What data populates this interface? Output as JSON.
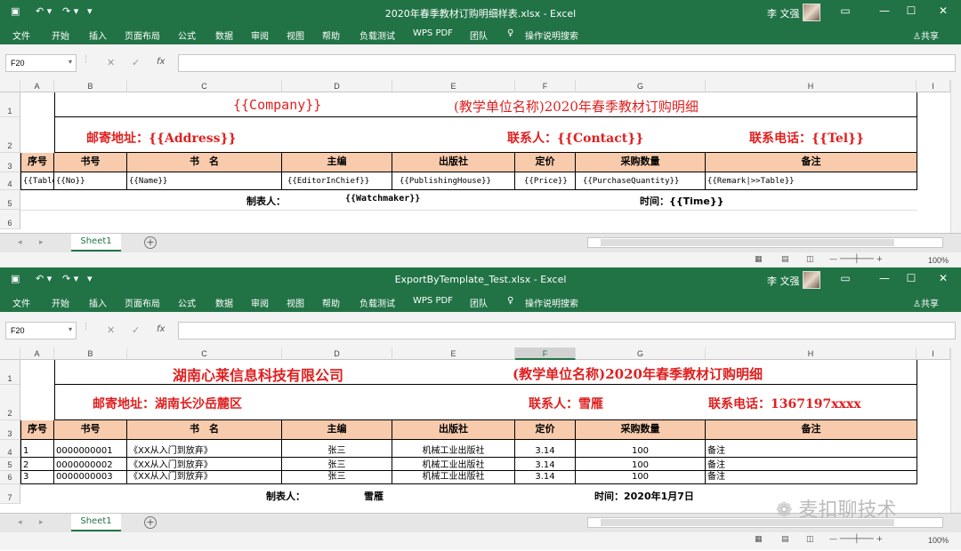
{
  "ribbon_tabs": [
    "文件",
    "开始",
    "插入",
    "页面布局",
    "公式",
    "数据",
    "审阅",
    "视图",
    "帮助",
    "负载测试",
    "WPS PDF",
    "团队"
  ],
  "tell_me": "操作说明搜索",
  "share": "共享",
  "user": "李 文强",
  "name_box": "F20",
  "fx": "fx",
  "columns": [
    "A",
    "B",
    "C",
    "D",
    "E",
    "F",
    "G",
    "H",
    "I"
  ],
  "sheet_tab": "Sheet1",
  "zoom": "100%",
  "template": {
    "title": "2020年春季教材订购明细样表.xlsx  -  Excel",
    "rows": [
      "1",
      "2",
      "3",
      "4",
      "5",
      "6"
    ],
    "company": "{{Company}}",
    "heading": "(教学单位名称)2020年春季教材订购明细",
    "address": "邮寄地址：{{Address}}",
    "contact": "联系人：{{Contact}}",
    "tel": "联系电话：{{Tel}}",
    "headers": [
      "序号",
      "书号",
      "书　名",
      "主编",
      "出版社",
      "定价",
      "采购数量",
      "备注"
    ],
    "placeholders": [
      "{{Table",
      "{{No}}",
      "{{Name}}",
      "{{EditorInChief}}",
      "{{PublishingHouse}}",
      "{{Price}}",
      "{{PurchaseQuantity}}",
      "{{Remark|>>Table}}"
    ],
    "maker_label": "制表人：",
    "maker": "{{Watchmaker}}",
    "time": "时间：{{Time}}"
  },
  "result": {
    "title": "ExportByTemplate_Test.xlsx  -  Excel",
    "rows": [
      "1",
      "2",
      "3",
      "4",
      "5",
      "6",
      "7"
    ],
    "company": "湖南心莱信息科技有限公司",
    "heading": "(教学单位名称)2020年春季教材订购明细",
    "address": "邮寄地址：湖南长沙岳麓区",
    "contact": "联系人：雪雁",
    "tel": "联系电话：1367197xxxx",
    "headers": [
      "序号",
      "书号",
      "书　名",
      "主编",
      "出版社",
      "定价",
      "采购数量",
      "备注"
    ],
    "data_rows": [
      [
        "1",
        "0000000001",
        "《XX从入门到放弃》",
        "张三",
        "机械工业出版社",
        "3.14",
        "100",
        "备注"
      ],
      [
        "2",
        "0000000002",
        "《XX从入门到放弃》",
        "张三",
        "机械工业出版社",
        "3.14",
        "100",
        "备注"
      ],
      [
        "3",
        "0000000003",
        "《XX从入门到放弃》",
        "张三",
        "机械工业出版社",
        "3.14",
        "100",
        "备注"
      ]
    ],
    "maker_label": "制表人：",
    "maker": "雪雁",
    "time": "时间：2020年1月7日"
  },
  "watermark": "麦扣聊技术",
  "colors": {
    "excel_green": "#217346",
    "header_fill": "#f8cbad",
    "red_text": "#e02020"
  }
}
